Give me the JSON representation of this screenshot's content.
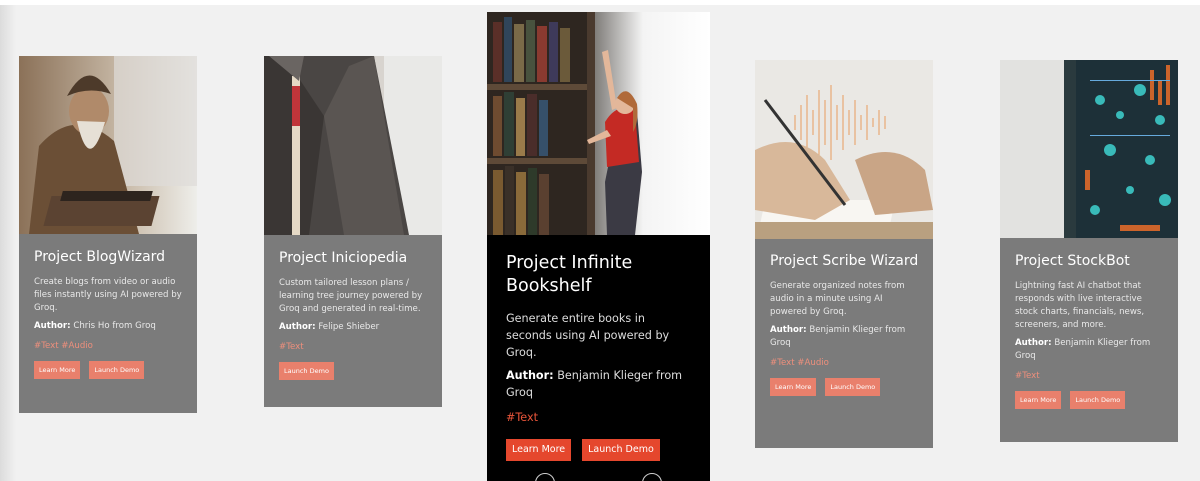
{
  "cards": [
    {
      "title": "Project BlogWizard",
      "description": "Create blogs from video or audio files instantly using AI powered by Groq.",
      "author_label": "Author:",
      "author": "Chris Ho from Groq",
      "tags": "#Text #Audio",
      "learn_more": "Learn More",
      "launch_demo": "Launch Demo",
      "image": "old-wizard-typing-image"
    },
    {
      "title": "Project Iniciopedia",
      "description": "Custom tailored lesson plans / learning tree journey powered by Groq and generated in real-time.",
      "author_label": "Author:",
      "author": "Felipe Shieber",
      "tags": "#Text",
      "launch_demo": "Launch Demo",
      "image": "tailor-suit-measuring-tape-image"
    },
    {
      "title": "Project Infinite Bookshelf",
      "description": "Generate entire books in seconds using AI powered by Groq.",
      "author_label": "Author:",
      "author": "Benjamin Klieger from Groq",
      "tags": "#Text",
      "learn_more": "Learn More",
      "launch_demo": "Launch Demo",
      "image": "woman-at-bookshelf-image"
    },
    {
      "title": "Project Scribe Wizard",
      "description": "Generate organized notes from audio in a minute using AI powered by Groq.",
      "author_label": "Author:",
      "author": "Benjamin Klieger from Groq",
      "tags": "#Text #Audio",
      "learn_more": "Learn More",
      "launch_demo": "Launch Demo",
      "image": "hands-writing-soundwave-image"
    },
    {
      "title": "Project StockBot",
      "description": "Lightning fast AI chatbot that responds with live interactive stock charts, financials, news, screeners, and more.",
      "author_label": "Author:",
      "author": "Benjamin Klieger from Groq",
      "tags": "#Text",
      "learn_more": "Learn More",
      "launch_demo": "Launch Demo",
      "image": "stock-market-screens-image"
    }
  ],
  "colors": {
    "card_bg": "#7b7b7b",
    "featured_bg": "#000000",
    "button": "#e9806c",
    "featured_button": "#e5472d",
    "tag": "#ee8f7c"
  }
}
